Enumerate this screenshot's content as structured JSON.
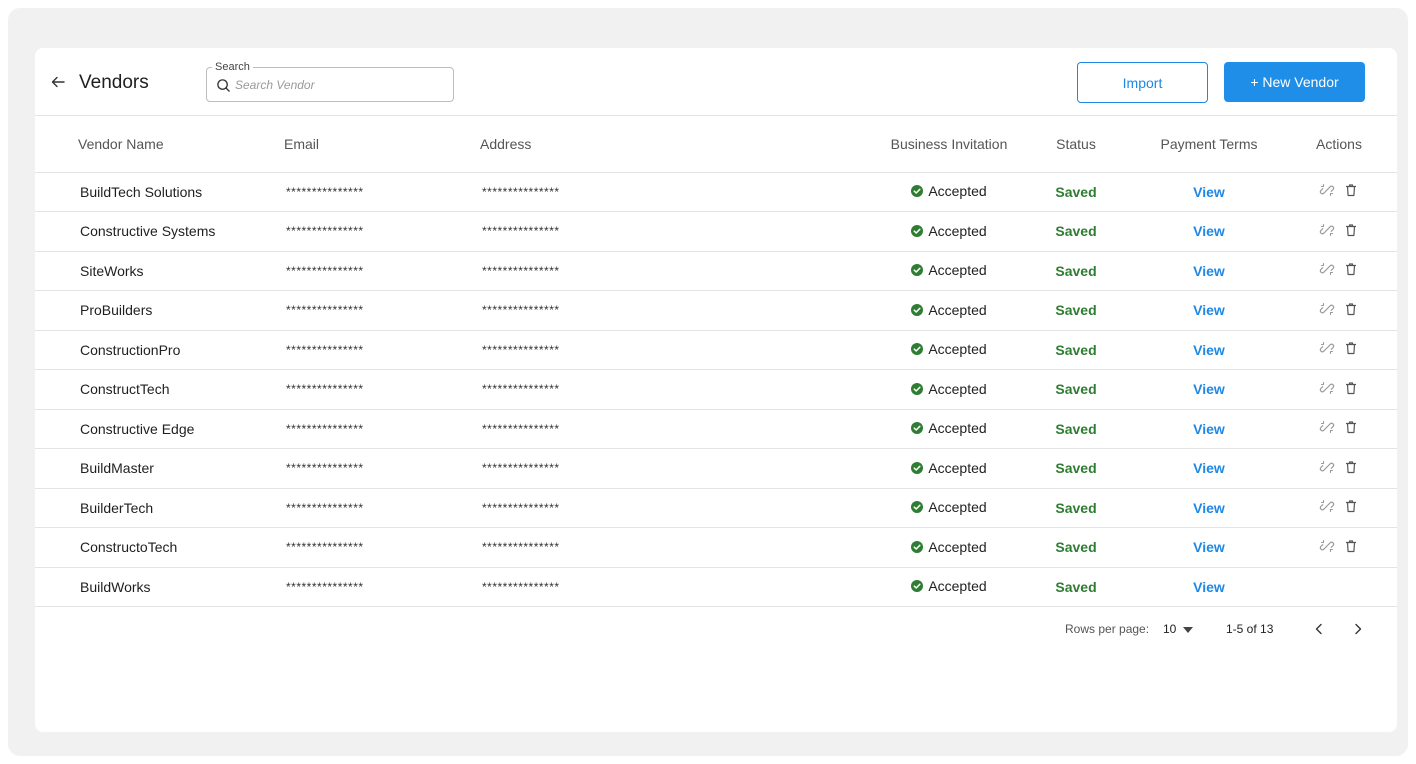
{
  "header": {
    "title": "Vendors",
    "search_label": "Search",
    "search_placeholder": "Search Vendor",
    "search_value": "",
    "import_label": "Import",
    "new_vendor_label": "+ New Vendor"
  },
  "columns": {
    "name": "Vendor Name",
    "email": "Email",
    "address": "Address",
    "invitation": "Business Invitation",
    "status": "Status",
    "payment": "Payment Terms",
    "actions": "Actions"
  },
  "rows": [
    {
      "name": "BuildTech Solutions",
      "email": "***************",
      "address": "***************",
      "invitation": "Accepted",
      "status": "Saved",
      "payment": "View",
      "actions": true
    },
    {
      "name": "Constructive Systems",
      "email": "***************",
      "address": "***************",
      "invitation": "Accepted",
      "status": "Saved",
      "payment": "View",
      "actions": true
    },
    {
      "name": "SiteWorks",
      "email": "***************",
      "address": "***************",
      "invitation": "Accepted",
      "status": "Saved",
      "payment": "View",
      "actions": true
    },
    {
      "name": "ProBuilders",
      "email": "***************",
      "address": "***************",
      "invitation": "Accepted",
      "status": "Saved",
      "payment": "View",
      "actions": true
    },
    {
      "name": "ConstructionPro",
      "email": "***************",
      "address": "***************",
      "invitation": "Accepted",
      "status": "Saved",
      "payment": "View",
      "actions": true
    },
    {
      "name": "ConstructTech",
      "email": "***************",
      "address": "***************",
      "invitation": "Accepted",
      "status": "Saved",
      "payment": "View",
      "actions": true
    },
    {
      "name": "Constructive Edge",
      "email": "***************",
      "address": "***************",
      "invitation": "Accepted",
      "status": "Saved",
      "payment": "View",
      "actions": true
    },
    {
      "name": "BuildMaster",
      "email": "***************",
      "address": "***************",
      "invitation": "Accepted",
      "status": "Saved",
      "payment": "View",
      "actions": true
    },
    {
      "name": "BuilderTech",
      "email": "***************",
      "address": "***************",
      "invitation": "Accepted",
      "status": "Saved",
      "payment": "View",
      "actions": true
    },
    {
      "name": "ConstructoTech",
      "email": "***************",
      "address": "***************",
      "invitation": "Accepted",
      "status": "Saved",
      "payment": "View",
      "actions": true
    },
    {
      "name": "BuildWorks",
      "email": "***************",
      "address": "***************",
      "invitation": "Accepted",
      "status": "Saved",
      "payment": "View",
      "actions": false
    }
  ],
  "pagination": {
    "rows_per_page_label": "Rows per page:",
    "rows_per_page_value": "10",
    "range": "1-5 of 13"
  },
  "icons": {
    "back": "arrow-left-icon",
    "search": "search-icon",
    "invitation": "check-circle-icon",
    "unlink": "unlink-icon",
    "delete": "trash-icon",
    "caret": "caret-down-icon",
    "prev": "chevron-left-icon",
    "next": "chevron-right-icon"
  },
  "colors": {
    "accent": "#1e88e5",
    "success": "#2e7d32",
    "frame": "#f1f1f1"
  }
}
